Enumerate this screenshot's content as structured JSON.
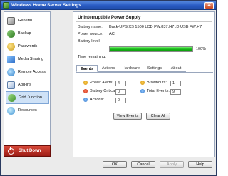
{
  "window": {
    "title": "Windows Home Server Settings"
  },
  "sidebar": {
    "items": [
      {
        "label": "General",
        "icon": "general-icon"
      },
      {
        "label": "Backup",
        "icon": "backup-icon"
      },
      {
        "label": "Passwords",
        "icon": "passwords-icon"
      },
      {
        "label": "Media Sharing",
        "icon": "media-sharing-icon"
      },
      {
        "label": "Remote Access",
        "icon": "remote-access-icon"
      },
      {
        "label": "Add-ins",
        "icon": "add-ins-icon"
      },
      {
        "label": "Grid Junction",
        "icon": "grid-junction-icon",
        "selected": true
      },
      {
        "label": "Resources",
        "icon": "resources-icon"
      }
    ],
    "shutdown_label": "Shut Down"
  },
  "panel": {
    "title": "Uninterruptible Power Supply",
    "battery_name_label": "Battery name:",
    "battery_name_value": "Back-UPS XS 1500 LCD FW:837.H7 .D USB FW:H7",
    "power_source_label": "Power source:",
    "power_source_value": "AC",
    "battery_level_label": "Battery level:",
    "battery_level_percent": 100,
    "battery_level_text": "100%",
    "time_remaining_label": "Time remaining:",
    "time_remaining_value": "",
    "tabs": [
      "Events",
      "Actions",
      "Hardware",
      "Settings",
      "About"
    ],
    "active_tab": "Events",
    "events": {
      "power_alerts_label": "Power Alerts:",
      "power_alerts_value": "4",
      "battery_critical_label": "Battery Critical:",
      "battery_critical_value": "0",
      "actions_label": "Actions:",
      "actions_value": "0",
      "brownouts_label": "Brownouts:",
      "brownouts_value": "1",
      "total_events_label": "Total Events:",
      "total_events_value": "9"
    },
    "view_events_label": "View Events",
    "clear_all_label": "Clear All"
  },
  "footer": {
    "ok_label": "OK",
    "cancel_label": "Cancel",
    "apply_label": "Apply",
    "help_label": "Help"
  },
  "colors": {
    "battery_fill": "#15b515",
    "shutdown": "#b52a1e",
    "titlebar": "#2a5cc4"
  }
}
